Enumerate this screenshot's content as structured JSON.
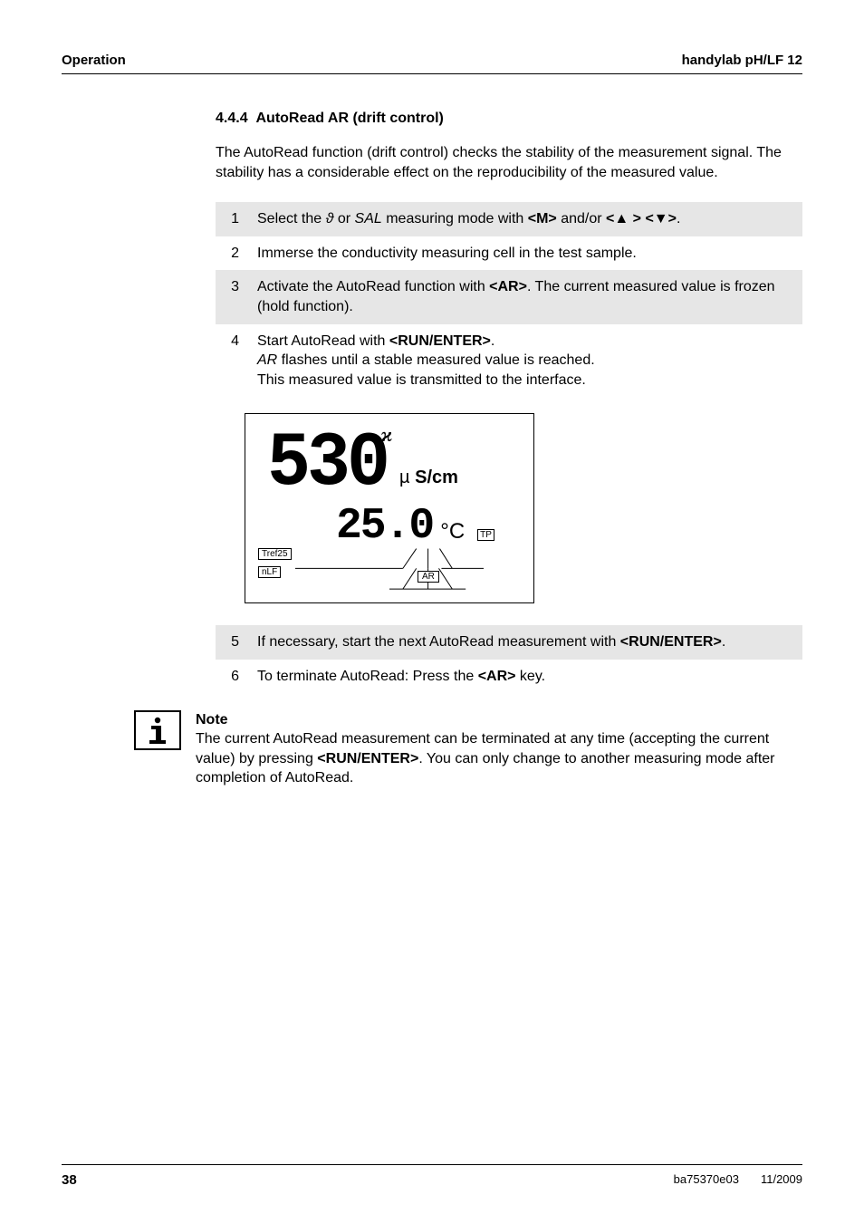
{
  "header": {
    "left": "Operation",
    "right": "handylab pH/LF 12"
  },
  "section": {
    "number": "4.4.4",
    "title": "AutoRead AR (drift control)"
  },
  "intro": "The AutoRead function (drift control) checks the stability of the measurement signal. The stability has a considerable effect on the reproducibility of the measured value.",
  "steps_a": [
    {
      "n": "1",
      "html": "Select the <i>ϑ</i> or <i>SAL</i> measuring mode with <b>&lt;M&gt;</b> and/or <b>&lt;▲ &gt;</b> <b>&lt;▼&gt;</b>."
    },
    {
      "n": "2",
      "html": "Immerse the conductivity measuring cell in the test sample."
    },
    {
      "n": "3",
      "html": "Activate the AutoRead function with <b>&lt;AR&gt;</b>. The current measured value is frozen (hold function)."
    },
    {
      "n": "4",
      "html": "Start AutoRead with <b>&lt;RUN/ENTER&gt;</b>.<br><i>AR</i> flashes until a stable measured value is reached.<br>This measured value is transmitted to the interface."
    }
  ],
  "lcd": {
    "main_value": "530",
    "main_unit_prefix": "µ",
    "main_unit": "S/cm",
    "sub_value": "25.0",
    "sub_unit": "°C",
    "tp": "TP",
    "tref": "Tref25",
    "nlf": "nLF",
    "ar": "AR",
    "x": "ϰ"
  },
  "steps_b": [
    {
      "n": "5",
      "html": "If necessary, start the next AutoRead measurement with <b>&lt;RUN/ENTER&gt;</b>."
    },
    {
      "n": "6",
      "html": "To terminate AutoRead: Press the <b>&lt;AR&gt;</b> key."
    }
  ],
  "note": {
    "title": "Note",
    "body": "The current AutoRead measurement can be terminated at any time (accepting the current value) by pressing <b>&lt;RUN/ENTER&gt;</b>. You can only change to another measuring mode after completion of AutoRead."
  },
  "footer": {
    "page": "38",
    "doc": "ba75370e03",
    "date": "11/2009"
  }
}
